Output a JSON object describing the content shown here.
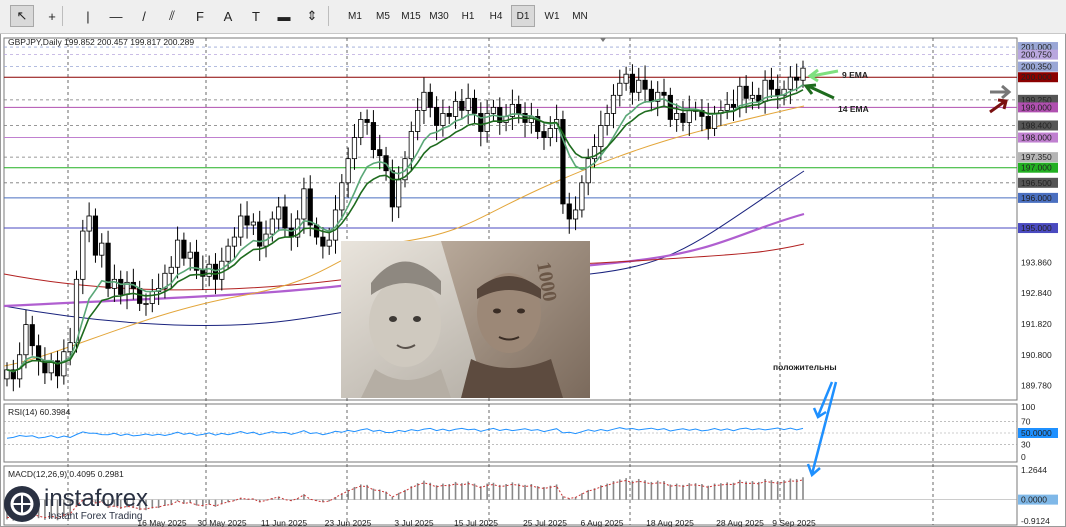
{
  "toolbar": {
    "tools": [
      {
        "name": "cursor-tool",
        "glyph": "↖"
      },
      {
        "name": "crosshair-tool",
        "glyph": "+"
      },
      {
        "name": "vertical-line-tool",
        "glyph": "|"
      },
      {
        "name": "horizontal-line-tool",
        "glyph": "—"
      },
      {
        "name": "trendline-tool",
        "glyph": "/"
      },
      {
        "name": "equidistant-channel-tool",
        "glyph": "⫽"
      },
      {
        "name": "fibonacci-tool",
        "glyph": "F"
      },
      {
        "name": "text-tool",
        "glyph": "A"
      },
      {
        "name": "text-label-tool",
        "glyph": "T"
      },
      {
        "name": "rectangle-label-tool",
        "glyph": "▬"
      },
      {
        "name": "arrows-tool",
        "glyph": "⇕"
      }
    ],
    "timeframes": [
      "M1",
      "M5",
      "M15",
      "M30",
      "H1",
      "H4",
      "D1",
      "W1",
      "MN"
    ],
    "active_timeframe": "D1"
  },
  "chart": {
    "header": "GBPJPY,Daily  199.852 200.457 199.817 200.289",
    "price_labels": [
      "201.000",
      "200.750",
      "200.350",
      "200.000",
      "199.250",
      "199.000",
      "198.400",
      "198.000",
      "197.350",
      "197.000",
      "196.500",
      "196.000",
      "195.000",
      "193.860",
      "192.840",
      "191.820",
      "190.800",
      "189.780"
    ],
    "date_labels": [
      "16 May 2025",
      "30 May 2025",
      "11 Jun 2025",
      "23 Jun 2025",
      "3 Jul 2025",
      "15 Jul 2025",
      "25 Jul 2025",
      "6 Aug 2025",
      "18 Aug 2025",
      "28 Aug 2025",
      "9 Sep 2025"
    ],
    "annotations": {
      "ema9": "9 EMA",
      "ema14": "14 EMA",
      "positive": "положительны"
    }
  },
  "rsi": {
    "header": "RSI(14) 60.3984",
    "levels": [
      "100",
      "70",
      "50.0000",
      "30",
      "0"
    ]
  },
  "macd": {
    "header": "MACD(12,26,9) 0.4095 0.2981",
    "levels": [
      "1.2644",
      "0.0000",
      "-0.9124"
    ]
  },
  "watermark": {
    "brand": "instaforex",
    "tagline": "Instant Forex Trading"
  },
  "chart_data": {
    "type": "candlestick",
    "symbol": "GBPJPY",
    "timeframe": "Daily",
    "ohlc_last": {
      "open": 199.852,
      "high": 200.457,
      "low": 199.817,
      "close": 200.289
    },
    "ylim": [
      189.3,
      201.3
    ],
    "x_ticks": [
      "16 May 2025",
      "30 May 2025",
      "11 Jun 2025",
      "23 Jun 2025",
      "3 Jul 2025",
      "15 Jul 2025",
      "25 Jul 2025",
      "6 Aug 2025",
      "18 Aug 2025",
      "28 Aug 2025",
      "9 Sep 2025"
    ],
    "closes": [
      190.3,
      190.0,
      190.8,
      191.8,
      191.1,
      190.6,
      190.2,
      190.6,
      190.1,
      190.9,
      191.2,
      193.3,
      194.9,
      195.4,
      194.1,
      194.5,
      193.0,
      193.3,
      192.8,
      193.2,
      193.0,
      192.5,
      192.5,
      192.9,
      193.0,
      193.5,
      193.7,
      194.6,
      194.0,
      194.2,
      193.6,
      193.4,
      193.8,
      193.3,
      193.9,
      194.4,
      194.7,
      195.4,
      195.1,
      195.2,
      194.4,
      194.8,
      195.3,
      195.7,
      195.0,
      194.7,
      195.3,
      196.3,
      195.1,
      194.7,
      194.4,
      194.6,
      195.6,
      196.5,
      197.3,
      198.0,
      198.6,
      198.5,
      197.6,
      197.4,
      196.9,
      195.7,
      196.6,
      197.3,
      198.2,
      198.9,
      199.5,
      199.0,
      198.4,
      198.8,
      198.7,
      199.2,
      198.9,
      199.3,
      198.8,
      198.2,
      198.8,
      199.0,
      198.5,
      198.7,
      199.1,
      198.8,
      198.5,
      198.7,
      198.2,
      198.0,
      198.3,
      198.6,
      195.8,
      195.3,
      195.6,
      196.5,
      197.3,
      197.7,
      198.4,
      198.8,
      199.4,
      199.8,
      200.1,
      199.5,
      199.9,
      199.6,
      199.2,
      199.5,
      199.4,
      198.6,
      198.8,
      198.5,
      198.9,
      198.9,
      198.7,
      198.3,
      198.8,
      198.9,
      199.1,
      199.0,
      199.7,
      199.3,
      199.4,
      199.2,
      199.9,
      199.6,
      199.4,
      199.6,
      200.0,
      199.9,
      200.3
    ],
    "series": [
      {
        "name": "9 EMA",
        "color": "#5aa777"
      },
      {
        "name": "14 EMA",
        "color": "#1e6b1e"
      }
    ],
    "horizontal_levels": [
      201.0,
      200.75,
      200.35,
      200.0,
      199.25,
      199.0,
      198.4,
      198.0,
      197.35,
      197.0,
      196.5,
      196.0,
      195.0
    ],
    "rsi_value": 60.3984,
    "rsi_levels": [
      70,
      50,
      30
    ],
    "macd_main": 0.4095,
    "macd_signal": 0.2981,
    "macd_range": [
      -0.9124,
      1.2644
    ]
  }
}
